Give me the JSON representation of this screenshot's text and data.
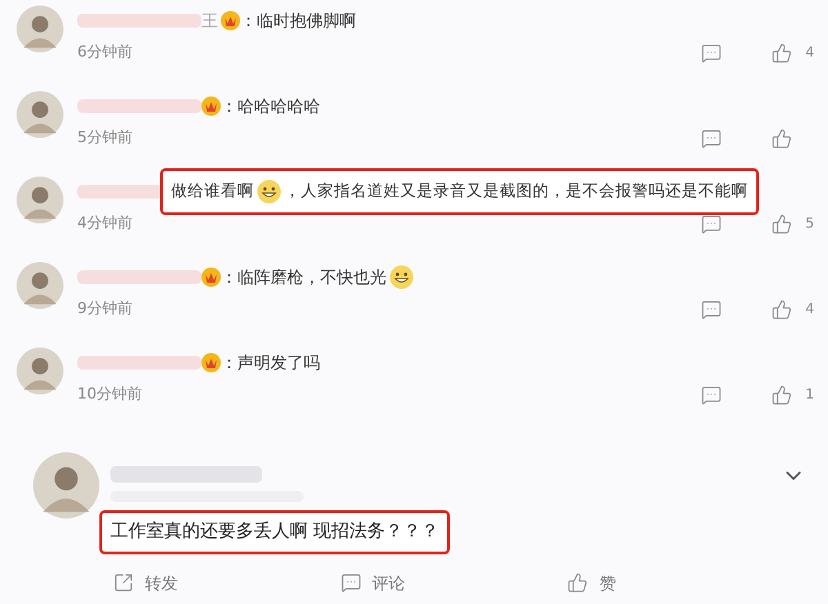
{
  "comments": [
    {
      "name": "王",
      "badge": true,
      "highlighted": false,
      "segments": [
        {
          "kind": "text",
          "text": "：临时抱佛脚啊"
        }
      ],
      "time": "6分钟前",
      "likes": "4"
    },
    {
      "badge": true,
      "highlighted": false,
      "segments": [
        {
          "kind": "text",
          "text": "：哈哈哈哈哈"
        }
      ],
      "time": "5分钟前"
    },
    {
      "badge": false,
      "highlighted": true,
      "segments": [
        {
          "kind": "text",
          "text": "做给谁看啊"
        },
        {
          "kind": "emoji"
        },
        {
          "kind": "text",
          "text": "，人家指名道姓又是录音又是截图的，是不会报警吗还是不能啊"
        }
      ],
      "time": "4分钟前",
      "likes": "5"
    },
    {
      "badge": true,
      "highlighted": false,
      "segments": [
        {
          "kind": "text",
          "text": "：临阵磨枪，不快也光"
        },
        {
          "kind": "emoji"
        }
      ],
      "time": "9分钟前",
      "likes": "4"
    },
    {
      "badge": true,
      "highlighted": false,
      "segments": [
        {
          "kind": "text",
          "text": "：声明发了吗"
        }
      ],
      "time": "10分钟前",
      "likes": "1"
    }
  ],
  "post": {
    "text": "工作室真的还要多丢人啊 现招法务？？？",
    "highlighted": true,
    "actions": [
      {
        "kind": "share",
        "label": "转发"
      },
      {
        "kind": "comment",
        "label": "评论"
      },
      {
        "kind": "like",
        "label": "赞"
      }
    ]
  }
}
